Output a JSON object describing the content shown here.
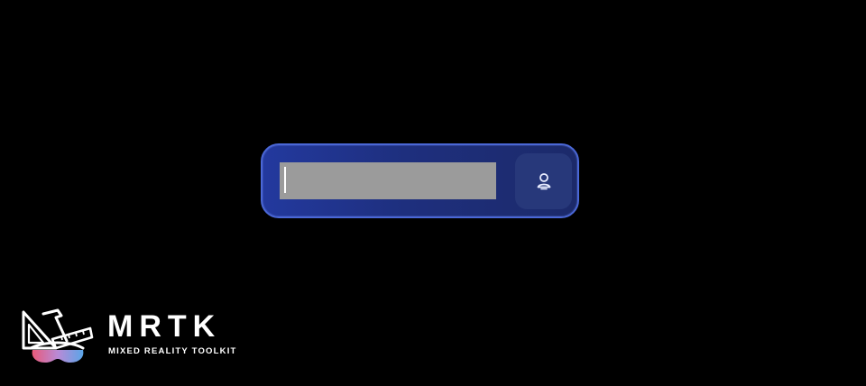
{
  "input_panel": {
    "field_value": "",
    "speech_button_icon": "microphone-person-icon"
  },
  "logo": {
    "title": "MRTK",
    "subtitle": "MIXED REALITY TOOLKIT",
    "icon": "mrtk-tools-headset-logo"
  },
  "colors": {
    "background": "#000000",
    "panel_border": "#4a67d6",
    "panel_fill": "#1e2f7e",
    "field_fill": "#9b9b9b",
    "button_fill": "#27387a"
  }
}
